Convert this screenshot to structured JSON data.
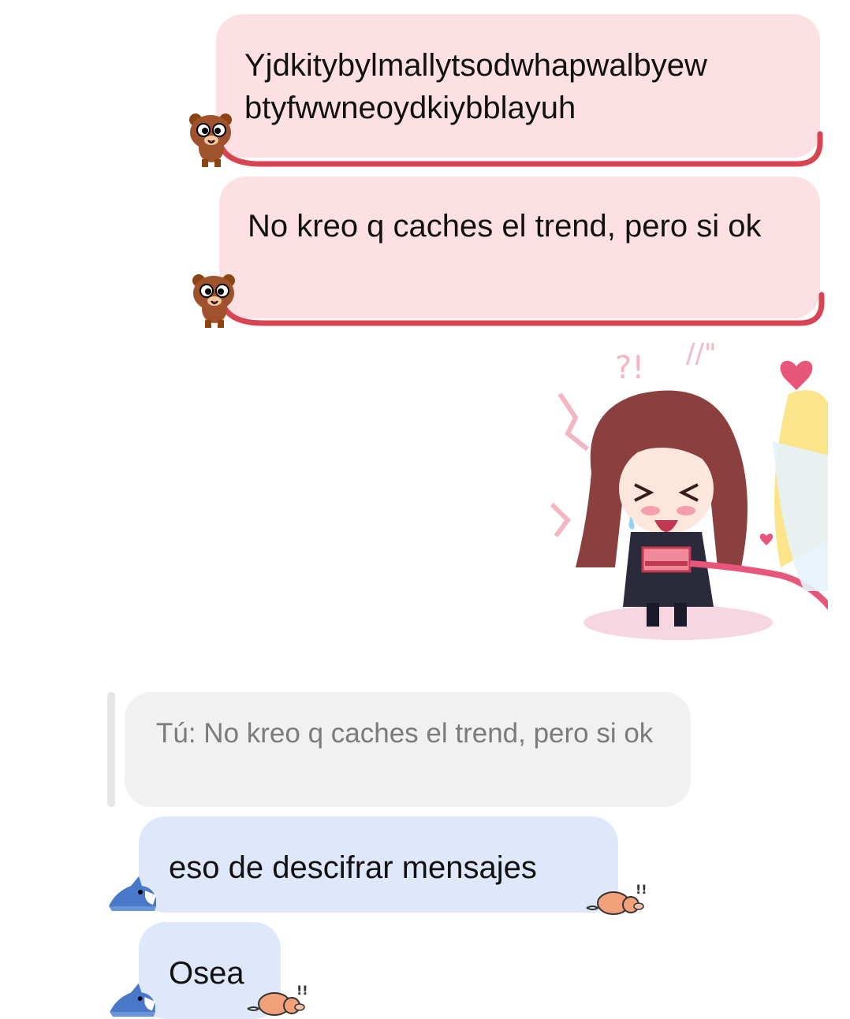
{
  "messages": {
    "out1": {
      "text": "Yjdkitybylmallytsodwhapwalbyew btyfwwneoydkiybblayuh"
    },
    "out2": {
      "text": "No kreo q caches el trend, pero si ok"
    },
    "sticker": {
      "icon": "anime-chibi-sticker"
    },
    "reply_quote": {
      "text": "Tú: No kreo q caches el trend, pero si ok"
    },
    "in1": {
      "text": "eso de descifrar mensajes"
    },
    "in2": {
      "text": "Osea"
    }
  },
  "colors": {
    "outgoing_bubble": "#fde0e3",
    "outgoing_accent": "#d94452",
    "incoming_bubble": "#dfe8fb",
    "reply_bubble": "#f1f1f1"
  },
  "icons": [
    "bear-sticker-icon",
    "shark-sticker-icon",
    "pig-sticker-icon"
  ]
}
